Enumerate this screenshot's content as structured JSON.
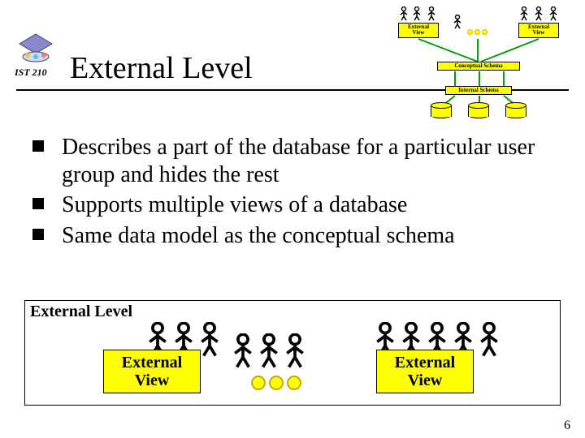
{
  "course_label": "IST 210",
  "title": "External Level",
  "bullets": [
    "Describes a part of the database for a particular user group and hides the rest",
    "Supports multiple views of a database",
    "Same data model as the conceptual schema"
  ],
  "mini_diagram": {
    "external_view_left": "External\nView",
    "external_view_right": "External\nView",
    "conceptual": "Conceptual Schema",
    "internal": "Internal Schema"
  },
  "bottom_frame": {
    "title": "External Level",
    "external_view_left": "External View",
    "external_view_right": "External View"
  },
  "page_number": "6"
}
